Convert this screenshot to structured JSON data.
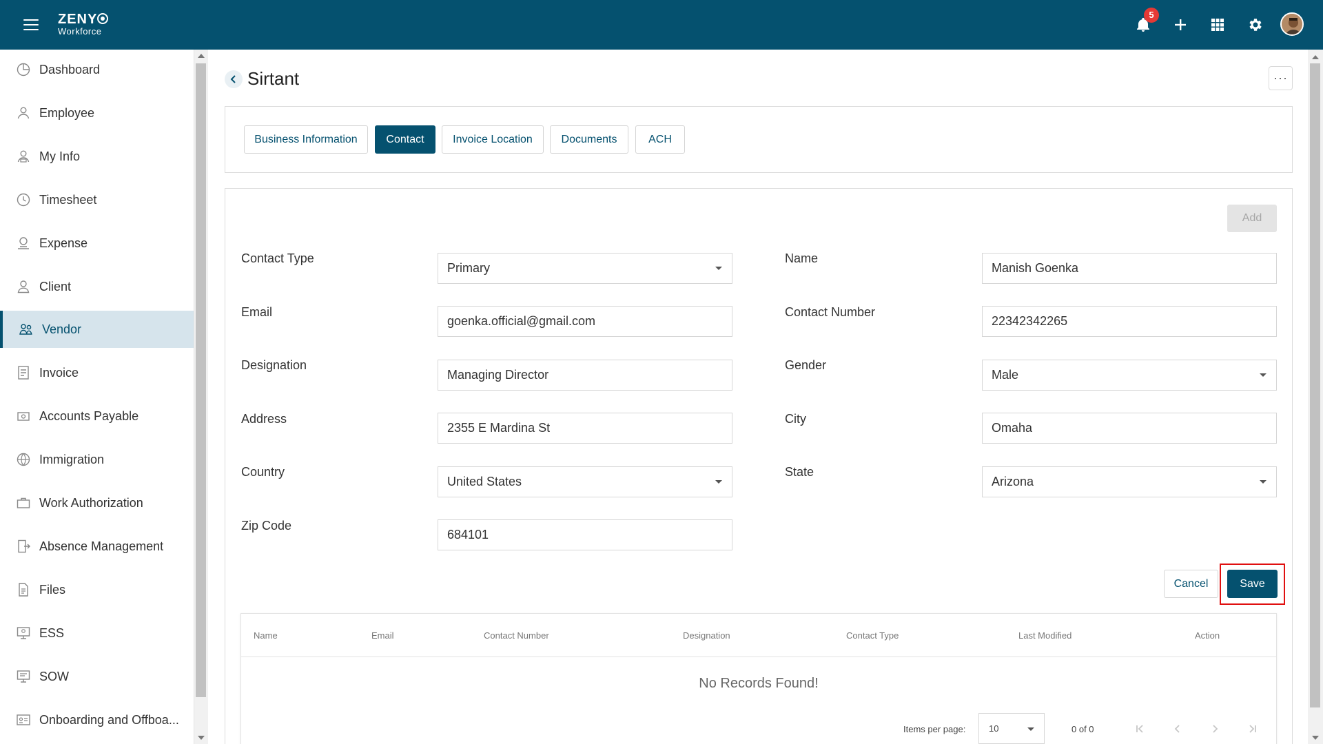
{
  "brand": {
    "line1": "ZENY",
    "line2": "Workforce"
  },
  "topbar": {
    "notification_count": "5",
    "icons": [
      "menu-icon",
      "bell-icon",
      "plus-icon",
      "apps-grid-icon",
      "gear-icon",
      "avatar"
    ]
  },
  "sidebar": {
    "items": [
      {
        "label": "Dashboard",
        "icon": "dashboard-icon"
      },
      {
        "label": "Employee",
        "icon": "employee-icon"
      },
      {
        "label": "My Info",
        "icon": "my-info-icon"
      },
      {
        "label": "Timesheet",
        "icon": "clock-icon"
      },
      {
        "label": "Expense",
        "icon": "expense-icon"
      },
      {
        "label": "Client",
        "icon": "client-icon"
      },
      {
        "label": "Vendor",
        "icon": "vendor-icon"
      },
      {
        "label": "Invoice",
        "icon": "invoice-icon"
      },
      {
        "label": "Accounts Payable",
        "icon": "accounts-payable-icon"
      },
      {
        "label": "Immigration",
        "icon": "globe-icon"
      },
      {
        "label": "Work Authorization",
        "icon": "briefcase-icon"
      },
      {
        "label": "Absence Management",
        "icon": "exit-door-icon"
      },
      {
        "label": "Files",
        "icon": "file-icon"
      },
      {
        "label": "ESS",
        "icon": "ess-icon"
      },
      {
        "label": "SOW",
        "icon": "sow-icon"
      },
      {
        "label": "Onboarding and Offboa...",
        "icon": "id-card-icon"
      }
    ],
    "active_index": 6
  },
  "page": {
    "title": "Sirtant",
    "more_label": "···"
  },
  "tabs": [
    {
      "label": "Business Information"
    },
    {
      "label": "Contact"
    },
    {
      "label": "Invoice Location"
    },
    {
      "label": "Documents"
    },
    {
      "label": "ACH"
    }
  ],
  "active_tab": "Contact",
  "form": {
    "add_label": "Add",
    "contact_type": {
      "label": "Contact Type",
      "value": "Primary"
    },
    "name": {
      "label": "Name",
      "value": "Manish Goenka"
    },
    "email": {
      "label": "Email",
      "value": "goenka.official@gmail.com"
    },
    "contact_number": {
      "label": "Contact Number",
      "value": "22342342265"
    },
    "designation": {
      "label": "Designation",
      "value": "Managing Director"
    },
    "gender": {
      "label": "Gender",
      "value": "Male"
    },
    "address": {
      "label": "Address",
      "value": "2355 E Mardina St"
    },
    "city": {
      "label": "City",
      "value": "Omaha"
    },
    "country": {
      "label": "Country",
      "value": "United States"
    },
    "state": {
      "label": "State",
      "value": "Arizona"
    },
    "zip": {
      "label": "Zip Code",
      "value": "684101"
    },
    "cancel_label": "Cancel",
    "save_label": "Save"
  },
  "table": {
    "columns": [
      "Name",
      "Email",
      "Contact Number",
      "Designation",
      "Contact Type",
      "Last Modified",
      "Action"
    ],
    "empty_text": "No Records Found!",
    "items_per_page_label": "Items per page:",
    "items_per_page": "10",
    "range": "0 of 0"
  },
  "colors": {
    "primary": "#05516f",
    "badge": "#e53935",
    "highlight": "#e01010",
    "active_nav_bg": "#d6e4ec"
  }
}
